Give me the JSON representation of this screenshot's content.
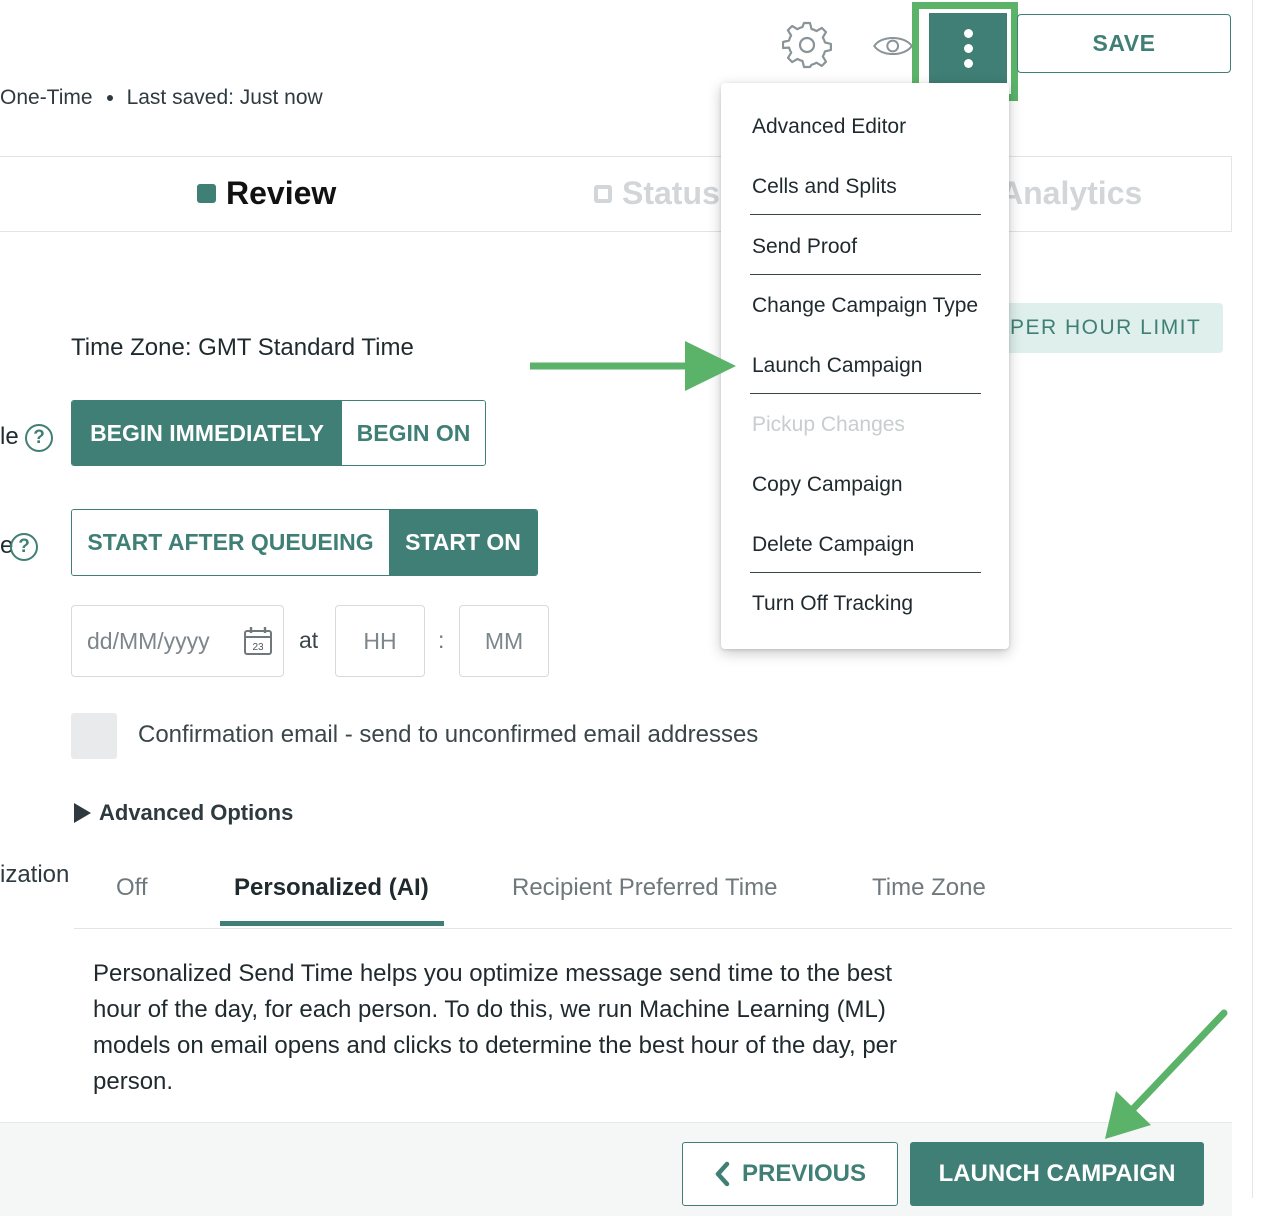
{
  "header": {
    "meta_type": "One-Time",
    "meta_saved": "Last saved: Just now",
    "save_label": "SAVE"
  },
  "steps": [
    {
      "label": "Review",
      "state": "active"
    },
    {
      "label": "Status",
      "state": "inactive"
    },
    {
      "label": "Analytics",
      "state": "inactive"
    }
  ],
  "per_hour_limit_label": "PER HOUR LIMIT",
  "schedule": {
    "time_zone": "Time Zone: GMT Standard Time",
    "row1_left_fragment": "le",
    "row2_left_fragment": "e",
    "begin_options": [
      "BEGIN IMMEDIATELY",
      "BEGIN ON"
    ],
    "begin_selected": "BEGIN IMMEDIATELY",
    "start_options": [
      "START AFTER QUEUEING",
      "START ON"
    ],
    "start_selected": "START ON",
    "date_placeholder": "dd/MM/yyyy",
    "calendar_day": "23",
    "at_label": "at",
    "hour_placeholder": "HH",
    "colon": ":",
    "minute_placeholder": "MM"
  },
  "confirmation_label": "Confirmation email - send to unconfirmed email addresses",
  "advanced_options_label": "Advanced Options",
  "send_time": {
    "left_fragment": "ization",
    "tabs": [
      "Off",
      "Personalized (AI)",
      "Recipient Preferred Time",
      "Time Zone"
    ],
    "active_tab": "Personalized (AI)",
    "description": "Personalized Send Time helps you optimize message send time to the best hour of the day, for each person. To do this, we run Machine Learning (ML) models on email opens and clicks to determine the best hour of the day, per person."
  },
  "footer": {
    "previous_label": "PREVIOUS",
    "launch_label": "LAUNCH CAMPAIGN"
  },
  "menu": {
    "items": [
      {
        "label": "Advanced Editor",
        "disabled": false
      },
      {
        "label": "Cells and Splits",
        "disabled": false
      },
      {
        "label": "Send Proof",
        "disabled": false
      },
      {
        "label": "Change Campaign Type",
        "disabled": false
      },
      {
        "label": "Launch Campaign",
        "disabled": false
      },
      {
        "label": "Pickup Changes",
        "disabled": true
      },
      {
        "label": "Copy Campaign",
        "disabled": false
      },
      {
        "label": "Delete Campaign",
        "disabled": false
      },
      {
        "label": "Turn Off Tracking",
        "disabled": false
      }
    ]
  },
  "colors": {
    "accent": "#3f7f75",
    "annotation_green": "#5bb36a",
    "light_accent_bg": "#dff0ec"
  },
  "icons": [
    "gear-icon",
    "eye-icon",
    "more-vertical-icon",
    "help-icon",
    "calendar-icon",
    "chevron-left-icon",
    "triangle-right-icon"
  ]
}
